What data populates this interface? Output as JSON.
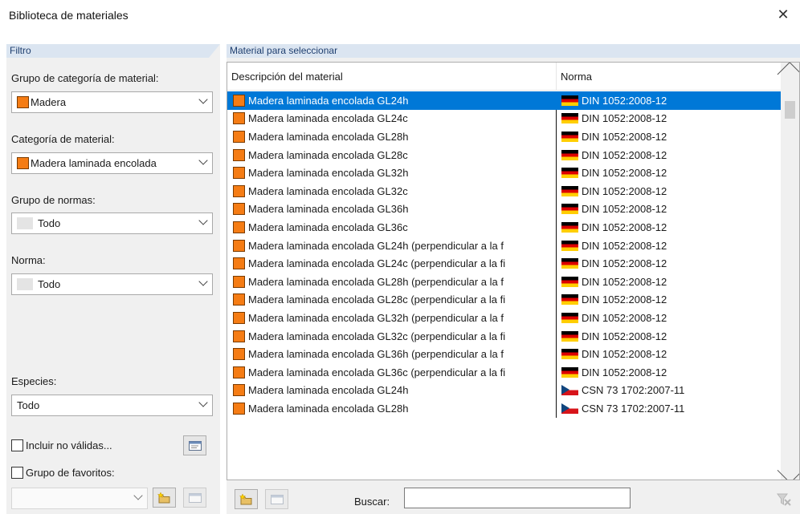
{
  "window": {
    "title": "Biblioteca de materiales",
    "close_glyph": "✕"
  },
  "filter": {
    "header": "Filtro",
    "category_group": {
      "label": "Grupo de categoría de material:",
      "value": "Madera",
      "color": "#f57c14"
    },
    "category": {
      "label": "Categoría de material:",
      "value": "Madera laminada encolada",
      "color": "#f57c14"
    },
    "norm_group": {
      "label": "Grupo de normas:",
      "value": "Todo"
    },
    "norm": {
      "label": "Norma:",
      "value": "Todo"
    },
    "species": {
      "label": "Especies:",
      "value": "Todo"
    },
    "include_invalid": {
      "label": "Incluir no válidas...",
      "checked": false
    },
    "favorites": {
      "label": "Grupo de favoritos:",
      "checked": false,
      "value": ""
    }
  },
  "list": {
    "header": "Material para seleccionar",
    "columns": [
      "Descripción del material",
      "Norma"
    ],
    "selected_index": 0,
    "rows": [
      {
        "desc": "Madera laminada encolada GL24h",
        "norm": "DIN 1052:2008-12",
        "flag": "de"
      },
      {
        "desc": "Madera laminada encolada GL24c",
        "norm": "DIN 1052:2008-12",
        "flag": "de"
      },
      {
        "desc": "Madera laminada encolada GL28h",
        "norm": "DIN 1052:2008-12",
        "flag": "de"
      },
      {
        "desc": "Madera laminada encolada GL28c",
        "norm": "DIN 1052:2008-12",
        "flag": "de"
      },
      {
        "desc": "Madera laminada encolada GL32h",
        "norm": "DIN 1052:2008-12",
        "flag": "de"
      },
      {
        "desc": "Madera laminada encolada GL32c",
        "norm": "DIN 1052:2008-12",
        "flag": "de"
      },
      {
        "desc": "Madera laminada encolada GL36h",
        "norm": "DIN 1052:2008-12",
        "flag": "de"
      },
      {
        "desc": "Madera laminada encolada GL36c",
        "norm": "DIN 1052:2008-12",
        "flag": "de"
      },
      {
        "desc": "Madera laminada encolada GL24h (perpendicular a la f",
        "norm": "DIN 1052:2008-12",
        "flag": "de"
      },
      {
        "desc": "Madera laminada encolada GL24c (perpendicular a la fi",
        "norm": "DIN 1052:2008-12",
        "flag": "de"
      },
      {
        "desc": "Madera laminada encolada GL28h (perpendicular a la f",
        "norm": "DIN 1052:2008-12",
        "flag": "de"
      },
      {
        "desc": "Madera laminada encolada GL28c (perpendicular a la fi",
        "norm": "DIN 1052:2008-12",
        "flag": "de"
      },
      {
        "desc": "Madera laminada encolada GL32h (perpendicular a la f",
        "norm": "DIN 1052:2008-12",
        "flag": "de"
      },
      {
        "desc": "Madera laminada encolada GL32c (perpendicular a la fi",
        "norm": "DIN 1052:2008-12",
        "flag": "de"
      },
      {
        "desc": "Madera laminada encolada GL36h (perpendicular a la f",
        "norm": "DIN 1052:2008-12",
        "flag": "de"
      },
      {
        "desc": "Madera laminada encolada GL36c (perpendicular a la fi",
        "norm": "DIN 1052:2008-12",
        "flag": "de"
      },
      {
        "desc": "Madera laminada encolada GL24h",
        "norm": "CSN 73 1702:2007-11",
        "flag": "cz"
      },
      {
        "desc": "Madera laminada encolada GL28h",
        "norm": "CSN 73 1702:2007-11",
        "flag": "cz"
      }
    ]
  },
  "search": {
    "label": "Buscar:",
    "value": ""
  },
  "icons": {
    "new_favorite": "new-folder-icon",
    "edit_favorite": "edit-icon",
    "clear_search": "clear-filter-icon"
  }
}
